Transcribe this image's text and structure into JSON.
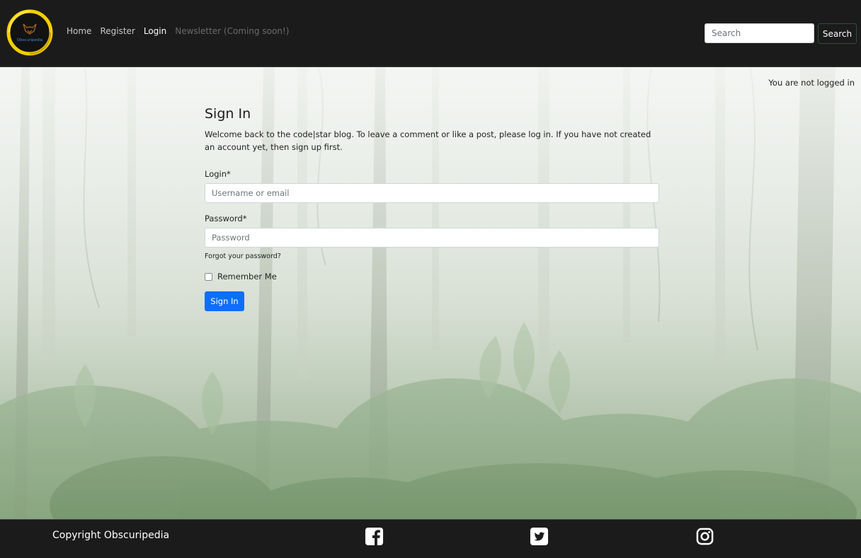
{
  "nav": {
    "logo_text": "Obscuripedia",
    "links": [
      {
        "label": "Home"
      },
      {
        "label": "Register"
      },
      {
        "label": "Login"
      },
      {
        "label": "Newsletter (Coming soon!)"
      }
    ],
    "search_placeholder": "Search",
    "search_button": "Search"
  },
  "status": {
    "login_text": "You are not logged in"
  },
  "signin": {
    "title": "Sign In",
    "intro": "Welcome back to the code|star blog. To leave a comment or like a post, please log in. If you have not created an account yet, then sign up first.",
    "login_label": "Login*",
    "login_placeholder": "Username or email",
    "password_label": "Password*",
    "password_placeholder": "Password",
    "forgot_link": "Forgot your password?",
    "remember_label": "Remember Me",
    "remember_checked": false,
    "submit_label": "Sign In"
  },
  "footer": {
    "copyright": "Copyright Obscuripedia",
    "social_icons": [
      "facebook-icon",
      "twitter-icon",
      "instagram-icon"
    ]
  },
  "colors": {
    "nav_bg": "#1b1b1b",
    "primary_button": "#0d6efd",
    "logo_ring": "#f4d000"
  }
}
